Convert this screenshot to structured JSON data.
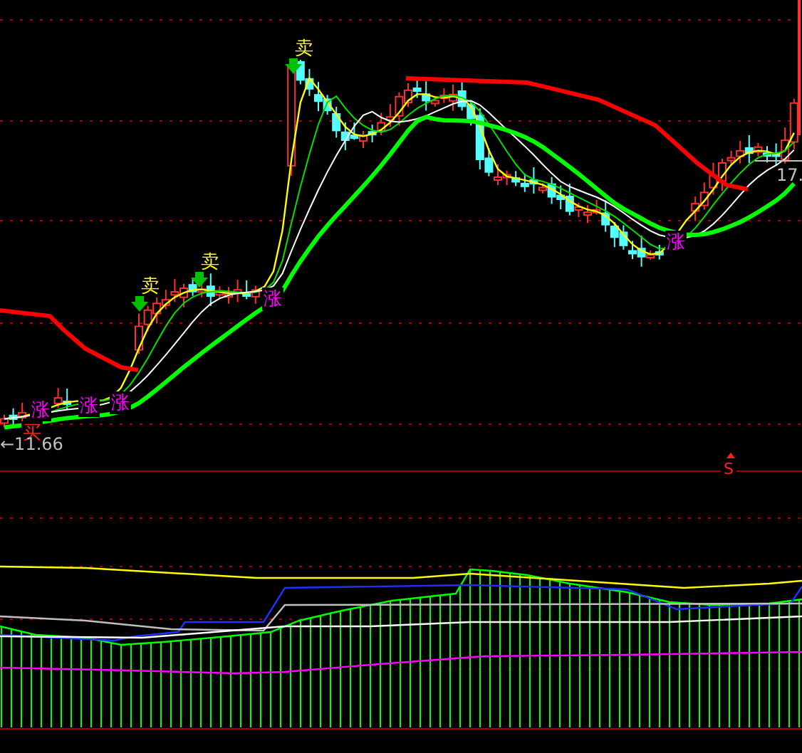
{
  "price_panel": {
    "markers": [
      {
        "kind": "rise",
        "text": "涨"
      },
      {
        "kind": "buy",
        "text": "买"
      },
      {
        "kind": "rise",
        "text": "涨"
      },
      {
        "kind": "rise",
        "text": "涨"
      },
      {
        "kind": "sell",
        "text": "卖"
      },
      {
        "kind": "sell",
        "text": "卖"
      },
      {
        "kind": "rise",
        "text": "涨"
      },
      {
        "kind": "sell",
        "text": "卖"
      },
      {
        "kind": "rise",
        "text": "涨"
      }
    ],
    "low_label": "←11.66",
    "right_label": "17."
  },
  "indicator_panel": {
    "signal": {
      "kind": "sell",
      "text": "S"
    }
  }
}
